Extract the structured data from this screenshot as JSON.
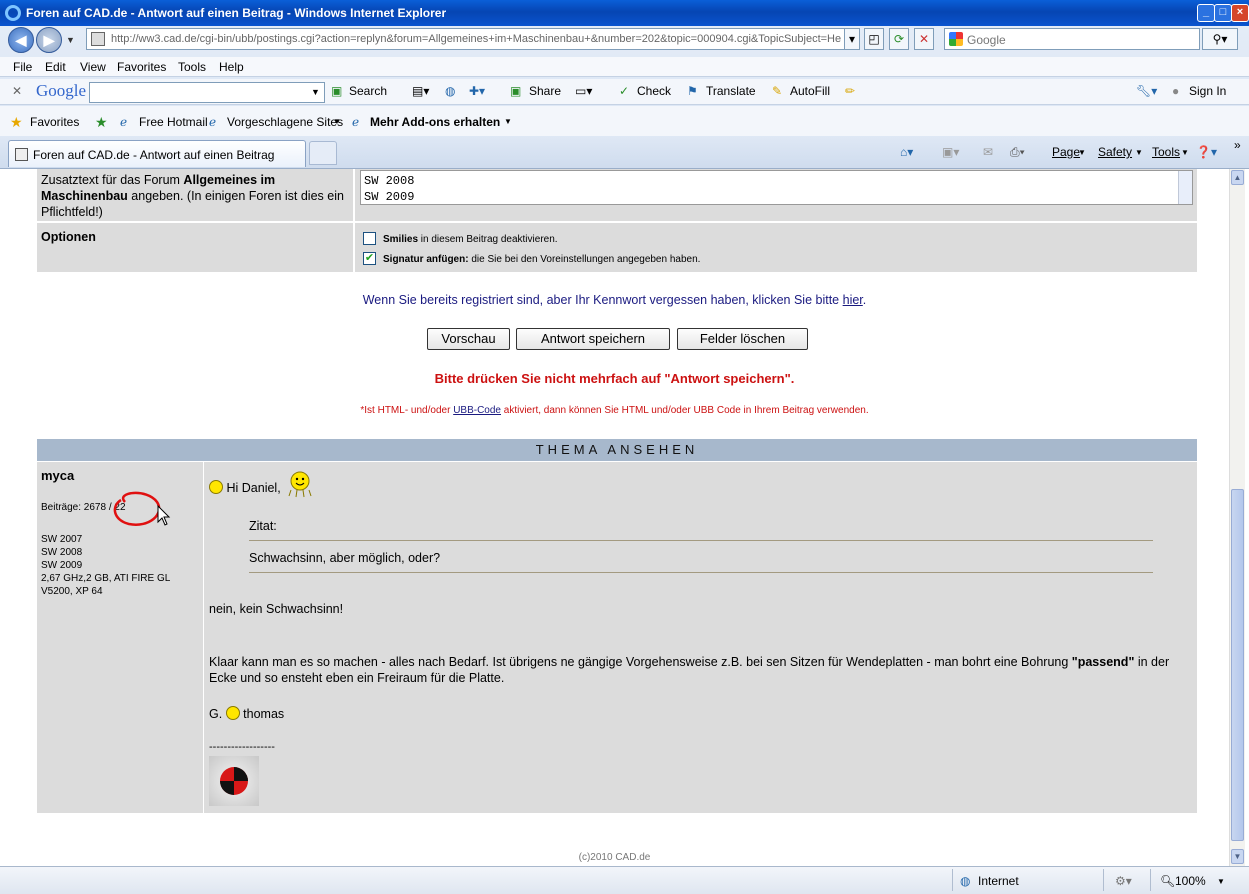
{
  "window": {
    "title": "Foren auf CAD.de - Antwort auf einen Beitrag - Windows Internet Explorer"
  },
  "address": {
    "url": "http://ww3.cad.de/cgi-bin/ubb/postings.cgi?action=replyn&forum=Allgemeines+im+Maschinenbau+&number=202&topic=000904.cgi&TopicSubject=He"
  },
  "search": {
    "placeholder": "Google"
  },
  "menu": [
    "File",
    "Edit",
    "View",
    "Favorites",
    "Tools",
    "Help"
  ],
  "google_toolbar": {
    "logo": "Google",
    "search": "Search",
    "share": "Share",
    "check": "Check",
    "translate": "Translate",
    "autofill": "AutoFill",
    "signin": "Sign In"
  },
  "favorites": {
    "label": "Favorites",
    "items": [
      "Free Hotmail",
      "Vorgeschlagene Sites",
      "Mehr Add-ons erhalten"
    ]
  },
  "tab": {
    "title": "Foren auf CAD.de - Antwort auf einen Beitrag"
  },
  "command_bar": {
    "page": "Page",
    "safety": "Safety",
    "tools": "Tools"
  },
  "form": {
    "zusatz_label_1": "Zusatztext für das Forum ",
    "zusatz_label_bold": "Allgemeines im Maschinenbau",
    "zusatz_label_2": " angeben. (In einigen Foren ist dies ein Pflichtfeld!)",
    "zusatz_lines": [
      "SW 2008",
      "SW 2009"
    ],
    "optionen_label": "Optionen",
    "opt1_bold": "Smilies",
    "opt1_text": " in diesem Beitrag deaktivieren.",
    "opt1_checked": false,
    "opt2_bold": "Signatur anfügen:",
    "opt2_text": " die Sie bei den Voreinstellungen angegeben haben.",
    "opt2_checked": true
  },
  "info": {
    "password_text": "Wenn Sie bereits registriert sind, aber Ihr Kennwort vergessen haben, klicken Sie bitte ",
    "password_link": "hier",
    "password_end": "."
  },
  "buttons": {
    "preview": "Vorschau",
    "save": "Antwort speichern",
    "clear": "Felder löschen"
  },
  "warning": "Bitte drücken Sie nicht mehrfach auf \"Antwort speichern\".",
  "html_note_1": "*Ist HTML- und/oder ",
  "html_note_link": "UBB-Code",
  "html_note_2": " aktiviert, dann können Sie HTML und/oder UBB Code in Ihrem Beitrag verwenden.",
  "thema_header": "THEMA ANSEHEN",
  "post": {
    "author": "myca",
    "beitraege": "Beiträge: 2678 / 22",
    "signature_lines": [
      "SW 2007",
      "SW 2008",
      "SW 2009",
      "2,67 GHz,2 GB, ATI FIRE GL",
      "V5200, XP 64"
    ],
    "greeting": "Hi Daniel,",
    "zitat_label": "Zitat:",
    "zitat_text": "Schwachsinn, aber möglich, oder?",
    "para1": "nein, kein Schwachsinn!",
    "para2_a": "Klaar kann man es so machen - alles nach Bedarf. Ist übrigens ne gängige Vorgehensweise z.B. bei sen Sitzen für Wendeplatten - man bohrt eine Bohrung ",
    "para2_bold": "\"passend\"",
    "para2_b": " in der Ecke und so ensteht eben ein Freiraum für die Platte.",
    "sign_g": "G.",
    "sign_name": "thomas",
    "sig_sep": "------------------"
  },
  "footer": "(c)2010 CAD.de",
  "status": {
    "zone": "Internet",
    "zoom": "100%"
  },
  "colors": {
    "warning": "#cc1111",
    "thema_bg": "#a7b8cc",
    "row_bg": "#dcdcdc",
    "link": "#1a1a80"
  }
}
